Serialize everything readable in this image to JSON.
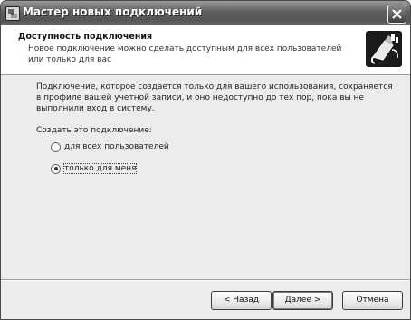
{
  "window": {
    "title": "Мастер новых подключений",
    "icon": "network-wizard-icon"
  },
  "header": {
    "title": "Доступность подключения",
    "description": "Новое подключение можно сделать доступным для всех пользователей или только для вас",
    "icon": "network-plug-icon"
  },
  "content": {
    "intro": "Подключение, которое создается только для вашего использования, сохраняется в профиле вашей учетной записи, и оно недоступно до тех пор, пока вы не выполнили вход в систему.",
    "prompt": "Создать это подключение:",
    "options": [
      {
        "label": "для всех пользователей",
        "checked": false
      },
      {
        "label": "только для меня",
        "checked": true
      }
    ]
  },
  "buttons": {
    "back": "< Назад",
    "next": "Далее >",
    "cancel": "Отмена"
  }
}
